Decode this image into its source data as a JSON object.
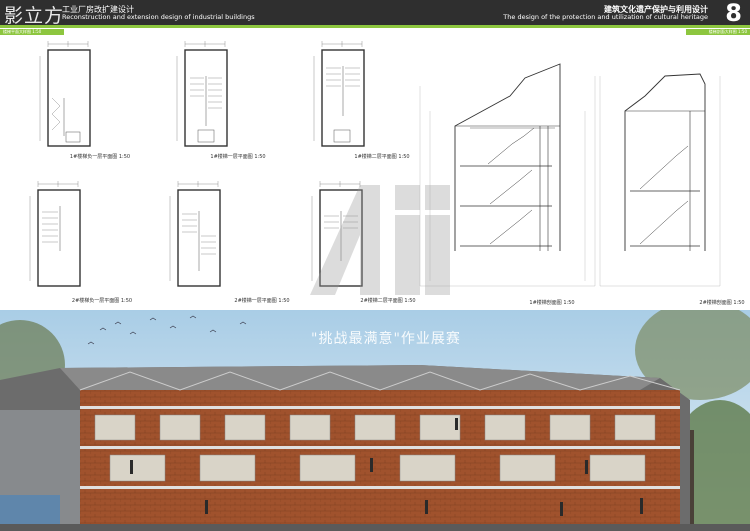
{
  "header": {
    "logo": "影立方",
    "title_cn": "工业厂房改扩建设计",
    "title_en": "Reconstruction and extension design of industrial buildings",
    "course_cn": "建筑文化遗产保护与利用设计",
    "course_en": "The design of the protection and utilization of cultural heritage",
    "page_number": "8"
  },
  "tags": {
    "left": "楼梯平面大样图 1:50",
    "right": "楼梯剖面大样图 1:50"
  },
  "captions": {
    "plan_1_basement": "1#楼梯负一层平面图 1:50",
    "plan_1_first": "1#楼梯一层平面图 1:50",
    "plan_1_second": "1#楼梯二层平面图 1:50",
    "plan_2_basement": "2#楼梯负一层平面图 1:50",
    "plan_2_first": "2#楼梯一层平面图 1:50",
    "plan_2_second": "2#楼梯二层平面图 1:50",
    "section_1": "1#楼梯剖面图 1:50",
    "section_2": "2#楼梯剖面图 1:50"
  },
  "watermark": {
    "text": "\"挑战最满意\"作业展赛"
  },
  "colors": {
    "header_bg": "#2f2f2f",
    "accent": "#8dc63f",
    "brick": "#a0522d",
    "sky": "#bcd7ea"
  },
  "icons": {
    "watermark_logo": "watermark-logo-icon"
  }
}
